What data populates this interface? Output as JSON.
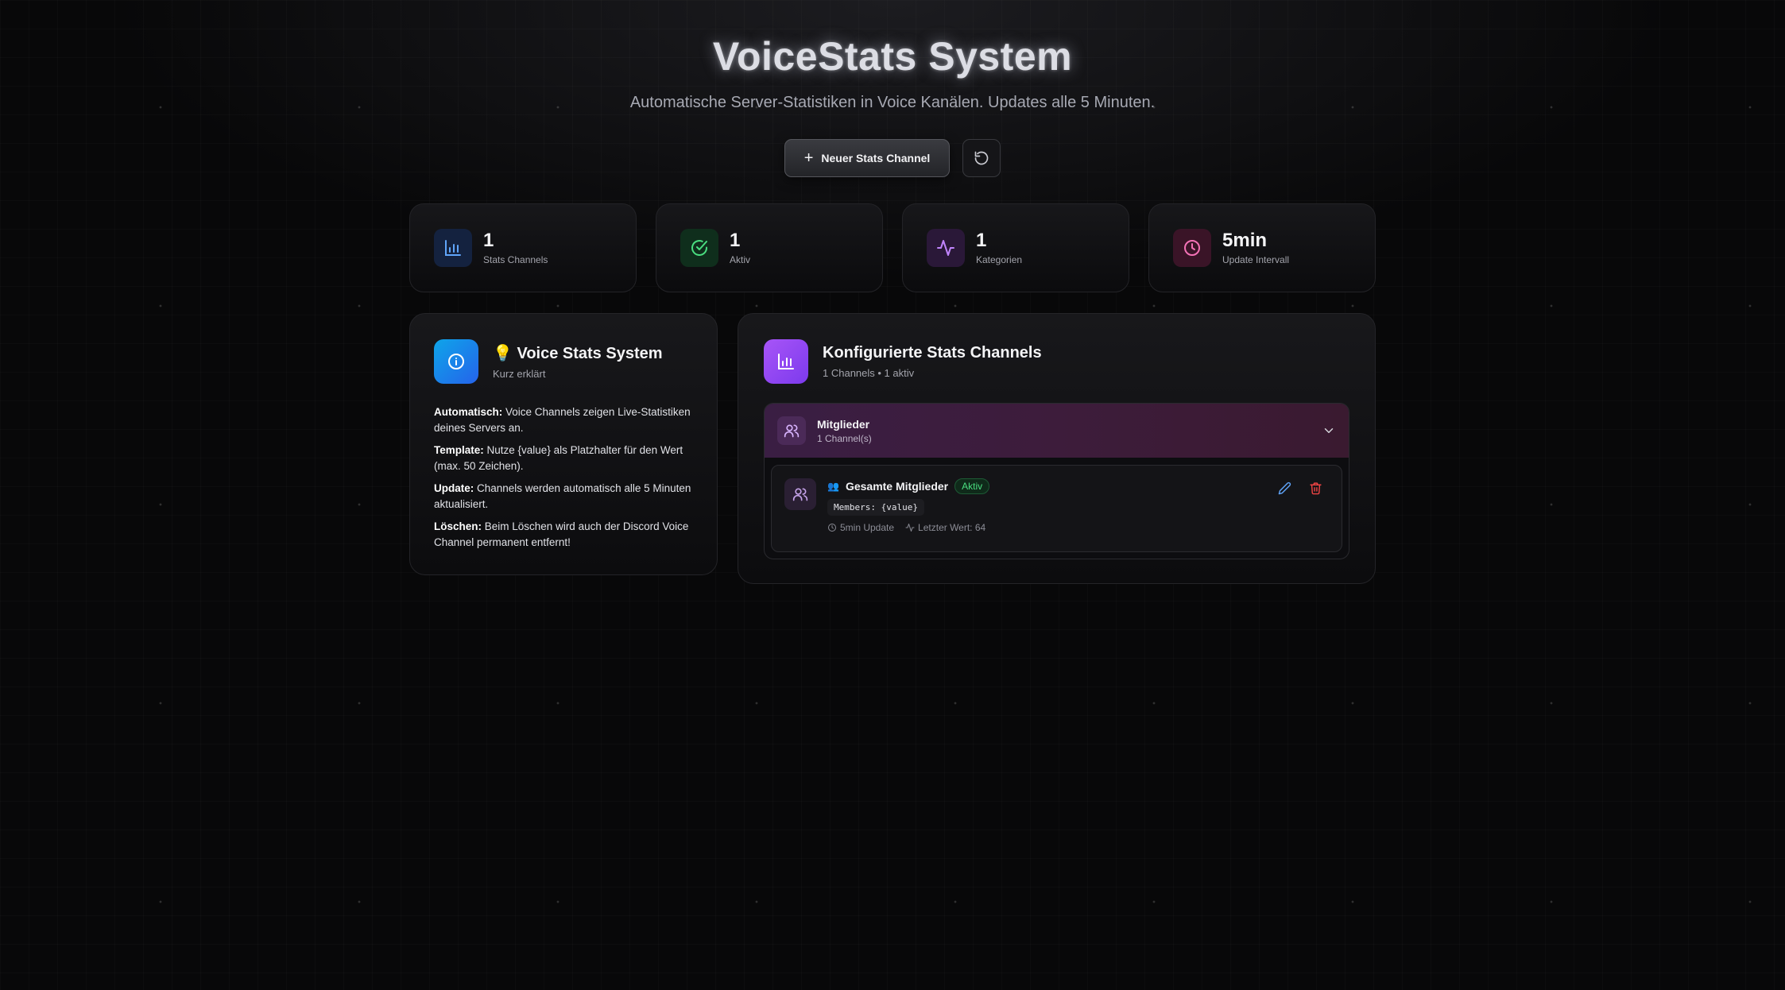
{
  "header": {
    "title": "VoiceStats System",
    "subtitle": "Automatische Server-Statistiken in Voice Kanälen. Updates alle 5 Minuten.",
    "new_channel_label": "Neuer Stats Channel"
  },
  "stats": [
    {
      "value": "1",
      "label": "Stats Channels",
      "icon": "bar-chart-icon",
      "color": "#3b82f6"
    },
    {
      "value": "1",
      "label": "Aktiv",
      "icon": "check-circle-icon",
      "color": "#22c55e"
    },
    {
      "value": "1",
      "label": "Kategorien",
      "icon": "activity-icon",
      "color": "#a855f7"
    },
    {
      "value": "5min",
      "label": "Update Intervall",
      "icon": "clock-icon",
      "color": "#ec4899"
    }
  ],
  "info": {
    "emoji": "💡",
    "title": "Voice Stats System",
    "subtitle": "Kurz erklärt",
    "items": [
      {
        "label": "Automatisch:",
        "text": " Voice Channels zeigen Live-Statistiken deines Servers an."
      },
      {
        "label": "Template:",
        "text": " Nutze {value} als Platzhalter für den Wert (max. 50 Zeichen)."
      },
      {
        "label": "Update:",
        "text": " Channels werden automatisch alle 5 Minuten aktualisiert."
      },
      {
        "label": "Löschen:",
        "text": " Beim Löschen wird auch der Discord Voice Channel permanent entfernt!"
      }
    ]
  },
  "config": {
    "title": "Konfigurierte Stats Channels",
    "subtitle": "1 Channels • 1 aktiv",
    "group": {
      "name": "Mitglieder",
      "count": "1 Channel(s)"
    },
    "channel": {
      "emoji": "👥",
      "name": "Gesamte Mitglieder",
      "status": "Aktiv",
      "template": "Members: {value}",
      "update": "5min Update",
      "last_value": "Letzter Wert: 64"
    }
  },
  "colors": {
    "accent_blue": "#0ea5e9",
    "accent_purple": "#a855f7",
    "status_green": "#4ade80",
    "danger_red": "#ef4444"
  }
}
